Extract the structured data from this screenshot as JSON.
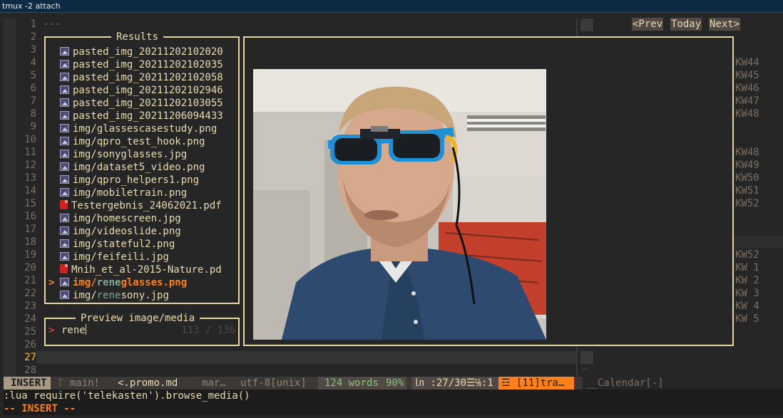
{
  "window": {
    "title": "tmux -2 attach"
  },
  "editor": {
    "first_line_text": "---",
    "current_line": 27,
    "line_numbers": [
      "1",
      "2",
      "3",
      "4",
      "5",
      "6",
      "7",
      "8",
      "9",
      "10",
      "11",
      "12",
      "13",
      "14",
      "15",
      "16",
      "17",
      "18",
      "19",
      "20",
      "21",
      "22",
      "23",
      "24",
      "25",
      "26",
      "27",
      "28"
    ]
  },
  "results": {
    "title": "Results",
    "selected_caret": ">",
    "items": [
      {
        "icon": "image-file-icon",
        "text": "pasted_img_20211202102020"
      },
      {
        "icon": "image-file-icon",
        "text": "pasted_img_20211202102035"
      },
      {
        "icon": "image-file-icon",
        "text": "pasted_img_20211202102058"
      },
      {
        "icon": "image-file-icon",
        "text": "pasted_img_20211202102946"
      },
      {
        "icon": "image-file-icon",
        "text": "pasted_img_20211202103055"
      },
      {
        "icon": "image-file-icon",
        "text": "pasted_img_20211206094433"
      },
      {
        "icon": "image-file-icon",
        "text": "img/glassescasestudy.png"
      },
      {
        "icon": "image-file-icon",
        "text": "img/qpro_test_hook.png"
      },
      {
        "icon": "image-file-icon",
        "text": "img/sonyglasses.jpg"
      },
      {
        "icon": "image-file-icon",
        "text": "img/dataset5_video.png"
      },
      {
        "icon": "image-file-icon",
        "text": "img/qpro_helpers1.png"
      },
      {
        "icon": "image-file-icon",
        "text": "img/mobiletrain.png"
      },
      {
        "icon": "pdf-file-icon",
        "text": "Testergebnis_24062021.pdf"
      },
      {
        "icon": "image-file-icon",
        "text": "img/homescreen.jpg"
      },
      {
        "icon": "image-file-icon",
        "text": "img/videoslide.png"
      },
      {
        "icon": "image-file-icon",
        "text": "img/stateful2.png"
      },
      {
        "icon": "image-file-icon",
        "text": "img/feifeili.jpg"
      },
      {
        "icon": "pdf-file-icon",
        "text": "Mnih_et_al-2015-Nature.pd"
      },
      {
        "icon": "image-file-icon",
        "pre": "img/",
        "match": "rene",
        "post": "glasses.png",
        "selected": true
      },
      {
        "icon": "image-file-icon",
        "pre": "img/",
        "match": "rene",
        "post": "sony.jpg"
      }
    ]
  },
  "prompt": {
    "title": "Preview image/media",
    "caret": ">",
    "query": "rene",
    "counter": "113 / 136"
  },
  "calendar": {
    "prev_label": "<Prev",
    "today_label": "Today",
    "next_label": "Next>",
    "weeks": [
      "KW44",
      "KW45",
      "KW46",
      "KW47",
      "KW48",
      "KW48",
      "KW49",
      "KW50",
      "KW51",
      "KW52",
      "KW52",
      "KW 1",
      "KW 2",
      "KW 3",
      "KW 4",
      "KW 5"
    ]
  },
  "statusline": {
    "mode": "INSERT",
    "branch": "main!",
    "file": "<.promo.md",
    "filetype": "mar…",
    "encoding": "utf-8[unix]",
    "words": "124 words",
    "percent": "90%",
    "position": "㏑ :27/30☰℅:1",
    "warning": "☲ [11]tra…",
    "right_buffer": "__Calendar[-]"
  },
  "cmdline": {
    "text": ":lua require('telekasten').browse_media()"
  },
  "modeline": {
    "text": "-- INSERT --"
  },
  "colors": {
    "accent": "#fe8019",
    "mode_bg": "#a89984",
    "warning_bg": "#fe8019",
    "border": "#e6d7a3"
  }
}
